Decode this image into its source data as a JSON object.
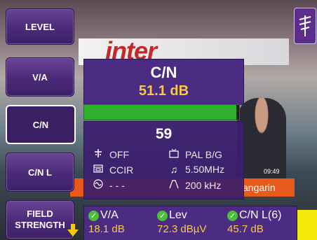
{
  "menu": {
    "level": "LEVEL",
    "va": "V/A",
    "cn": "C/N",
    "cnl": "C/N L",
    "field_line1": "FIELD",
    "field_line2": "STRENGTH"
  },
  "background": {
    "logo_text": "inter",
    "ticker_text": "angarin",
    "clock": "09:49"
  },
  "measurement": {
    "title": "C/N",
    "value": "51.1 dB",
    "bar_fill_fraction": 0.98,
    "bar_color": "#2fb02f"
  },
  "info": {
    "channel": "59",
    "lnb_power": "OFF",
    "standard": "CCIR",
    "sweep": "- - -",
    "system": "PAL B/G",
    "audio_freq": "5.50MHz",
    "bandwidth": "200 kHz"
  },
  "icons": {
    "lnb": "power-supply-icon",
    "standard": "channel-table-icon",
    "sweep": "sine-wave-icon",
    "system": "tv-icon",
    "audio": "music-note-icon",
    "bandwidth": "filter-icon",
    "antenna": "antenna-icon",
    "check": "check-icon",
    "down": "down-arrow-icon"
  },
  "results": {
    "va_label": "V/A",
    "va_value": "18.1 dB",
    "lev_label": "Lev",
    "lev_value": "72.3 dBµV",
    "cnl_label": "C/N L(6)",
    "cnl_value": "45.7 dB"
  },
  "colors": {
    "panel": "#4c2b82",
    "value_text": "#f6c94a",
    "check": "#4cbf3a"
  }
}
